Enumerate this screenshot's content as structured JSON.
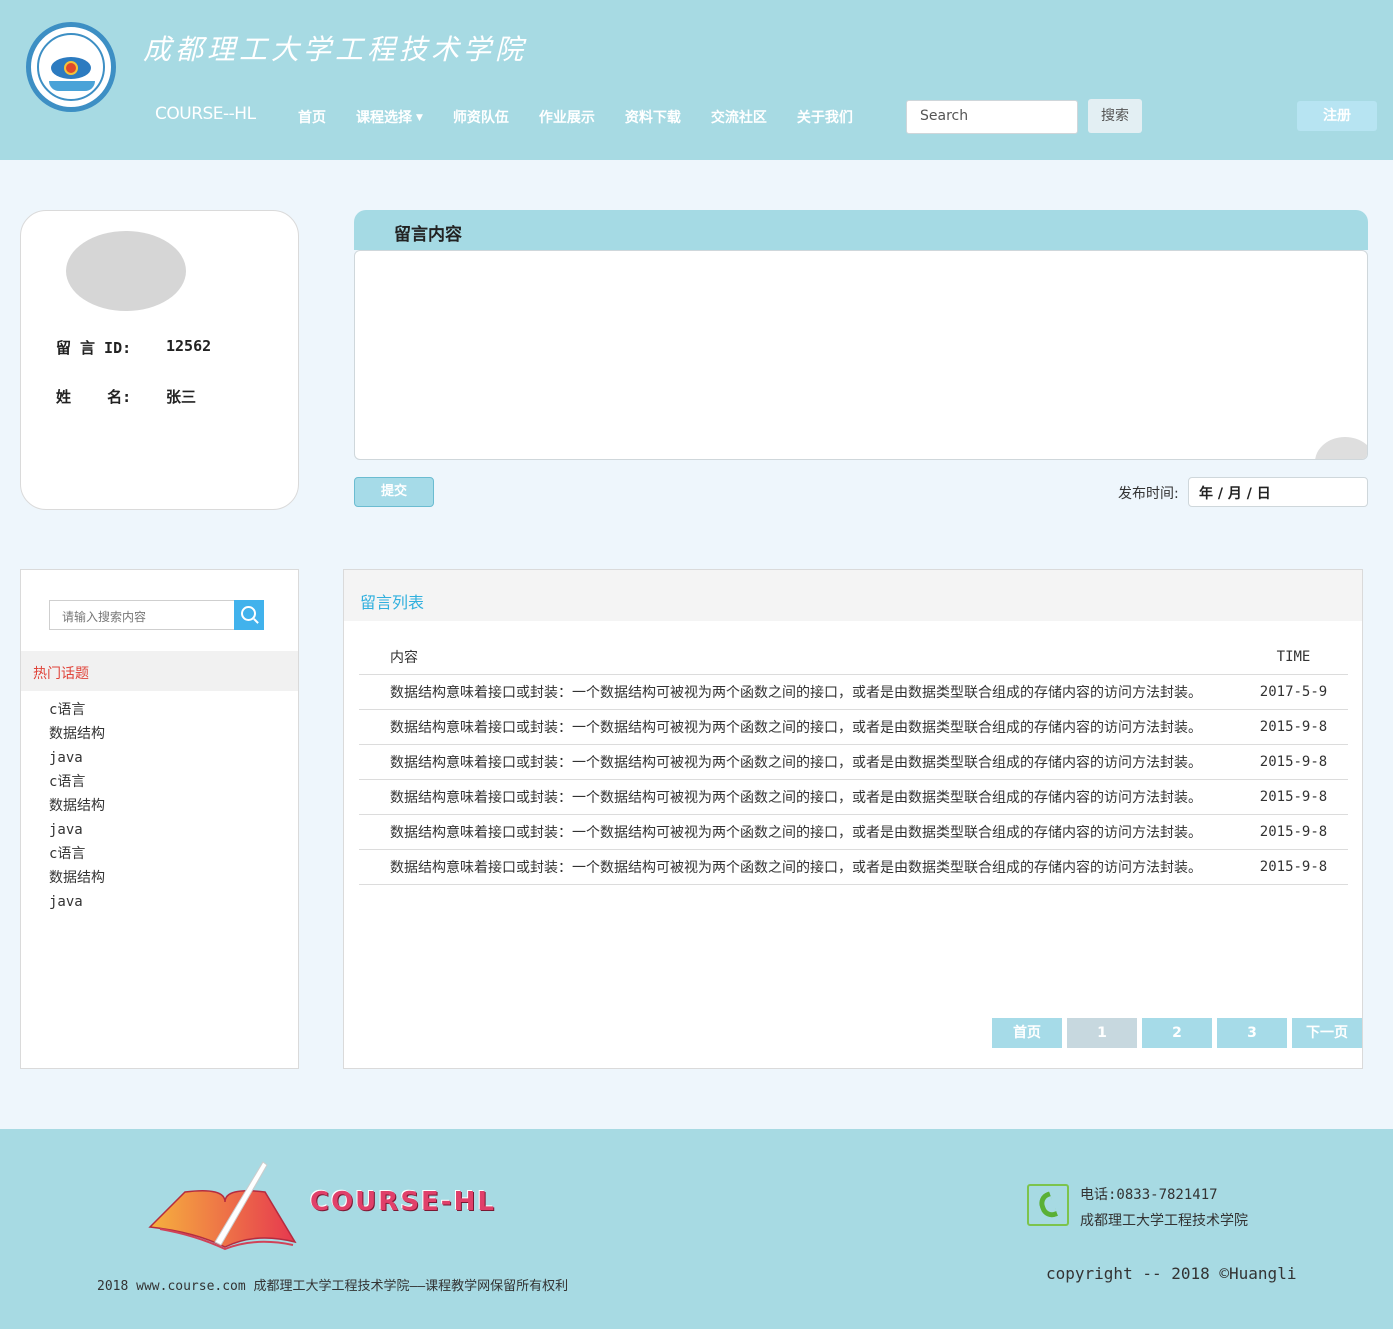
{
  "header": {
    "school_name": "成都理工大学工程技术学院",
    "brand": "COURSE--HL",
    "nav": [
      "首页",
      "课程选择",
      "师资队伍",
      "作业展示",
      "资料下载",
      "交流社区",
      "关于我们"
    ],
    "search_placeholder": "Search",
    "search_button": "搜索",
    "register_button": "注册"
  },
  "profile": {
    "id_label": "留 言 ID:",
    "id_value": "12562",
    "name_label": "姓    名:",
    "name_value": "张三"
  },
  "message": {
    "title": "留言内容",
    "submit": "提交",
    "publish_label": "发布时间:",
    "date_placeholder": "年 / 月 / 日"
  },
  "sidebar": {
    "search_placeholder": "请输入搜索内容",
    "hot_title": "热门话题",
    "topics": [
      "c语言",
      "数据结构",
      "java",
      "c语言",
      "数据结构",
      "java",
      "c语言",
      "数据结构",
      "java"
    ]
  },
  "list": {
    "title": "留言列表",
    "col_content": "内容",
    "col_time": "TIME",
    "rows": [
      {
        "content": "数据结构意味着接口或封装：一个数据结构可被视为两个函数之间的接口，或者是由数据类型联合组成的存储内容的访问方法封装。",
        "time": "2017-5-9"
      },
      {
        "content": "数据结构意味着接口或封装：一个数据结构可被视为两个函数之间的接口，或者是由数据类型联合组成的存储内容的访问方法封装。",
        "time": "2015-9-8"
      },
      {
        "content": "数据结构意味着接口或封装：一个数据结构可被视为两个函数之间的接口，或者是由数据类型联合组成的存储内容的访问方法封装。",
        "time": "2015-9-8"
      },
      {
        "content": "数据结构意味着接口或封装：一个数据结构可被视为两个函数之间的接口，或者是由数据类型联合组成的存储内容的访问方法封装。",
        "time": "2015-9-8"
      },
      {
        "content": "数据结构意味着接口或封装：一个数据结构可被视为两个函数之间的接口，或者是由数据类型联合组成的存储内容的访问方法封装。",
        "time": "2015-9-8"
      },
      {
        "content": "数据结构意味着接口或封装：一个数据结构可被视为两个函数之间的接口，或者是由数据类型联合组成的存储内容的访问方法封装。",
        "time": "2015-9-8"
      }
    ],
    "pager": [
      "首页",
      "1",
      "2",
      "3",
      "下一页"
    ]
  },
  "footer": {
    "logo_text": "COURSE-HL",
    "copyright_left": "2018 www.course.com 成都理工大学工程技术学院——课程教学网保留所有权利",
    "phone": "电话:0833-7821417",
    "school": "成都理工大学工程技术学院",
    "copyright_right": "copyright -- 2018 ©Huangli"
  },
  "colors": {
    "header_bg": "#a7dae3",
    "page_bg": "#eef6fc",
    "accent_blue": "#31b0de",
    "hot_red": "#e0443a"
  }
}
